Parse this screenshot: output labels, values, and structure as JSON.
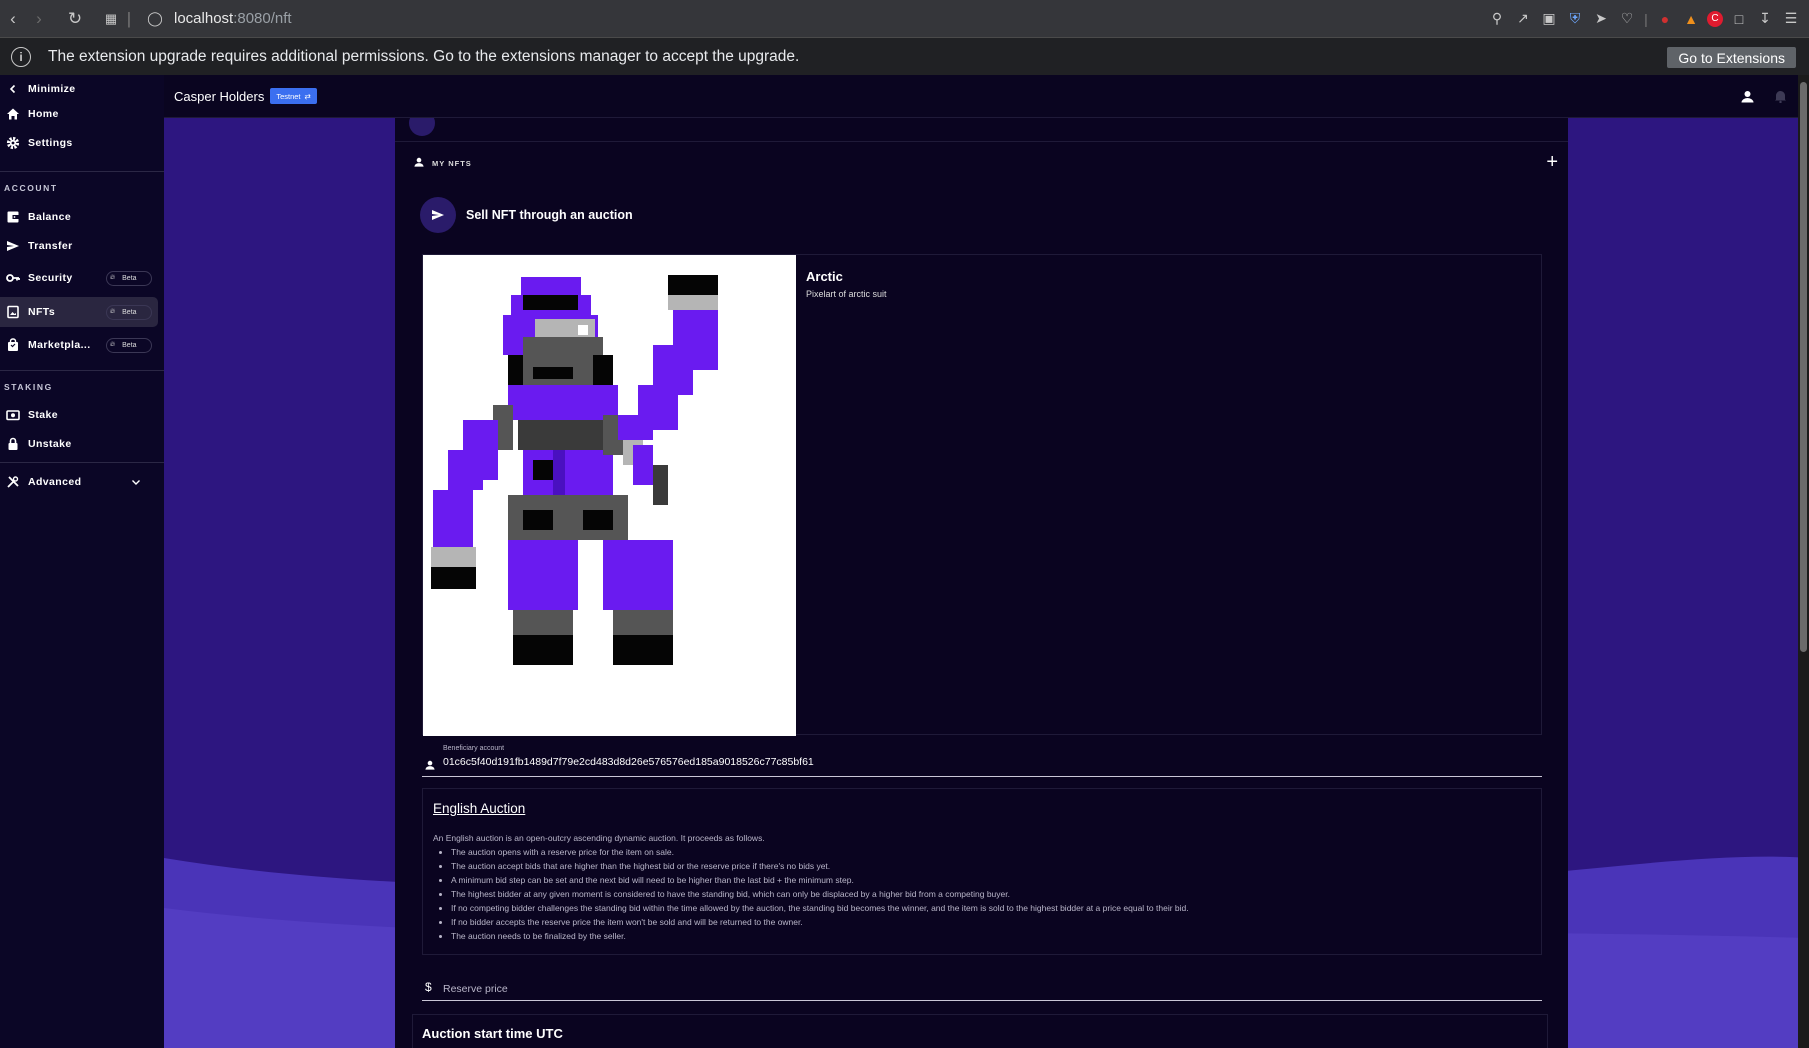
{
  "browser": {
    "url_host": "localhost",
    "url_path": ":8080/nft"
  },
  "infobar": {
    "message": "The extension upgrade requires additional permissions. Go to the extensions manager to accept the upgrade.",
    "button": "Go to Extensions"
  },
  "sidebar": {
    "minimize": "Minimize",
    "home": "Home",
    "settings": "Settings",
    "account_section": "ACCOUNT",
    "balance": "Balance",
    "transfer": "Transfer",
    "security": "Security",
    "nfts": "NFTs",
    "marketplace": "Marketpla...",
    "beta": "Beta",
    "staking_section": "STAKING",
    "stake": "Stake",
    "unstake": "Unstake",
    "advanced": "Advanced"
  },
  "topbar": {
    "brand": "Casper Holders",
    "network": "Testnet"
  },
  "main": {
    "section_title": "MY NFTS",
    "sell_label": "Sell NFT through an auction",
    "nft": {
      "name": "Arctic",
      "description": "Pixelart of arctic suit"
    },
    "beneficiary": {
      "label": "Beneficiary account",
      "value": "01c6c5f40d191fb1489d7f79e2cd483d8d26e576576ed185a9018526c77c85bf61"
    },
    "auction": {
      "title": "English Auction",
      "intro": "An English auction is an open-outcry ascending dynamic auction. It proceeds as follows.",
      "rules": [
        "The auction opens with a reserve price for the item on sale.",
        "The auction accept bids that are higher than the highest bid or the reserve price if there's no bids yet.",
        "A minimum bid step can be set and the next bid will need to be higher than the last bid + the minimum step.",
        "The highest bidder at any given moment is considered to have the standing bid, which can only be displaced by a higher bid from a competing buyer.",
        "If no competing bidder challenges the standing bid within the time allowed by the auction, the standing bid becomes the winner, and the item is sold to the highest bidder at a price equal to their bid.",
        "If no bidder accepts the reserve price the item won't be sold and will be returned to the owner.",
        "The auction needs to be finalized by the seller."
      ]
    },
    "reserve_price_placeholder": "Reserve price",
    "start_time_title": "Auction start time UTC"
  },
  "colors": {
    "accent": "#3b6ff0",
    "background": "#0a0420",
    "stage": "#2d1680",
    "wave": "#4a34b8"
  }
}
